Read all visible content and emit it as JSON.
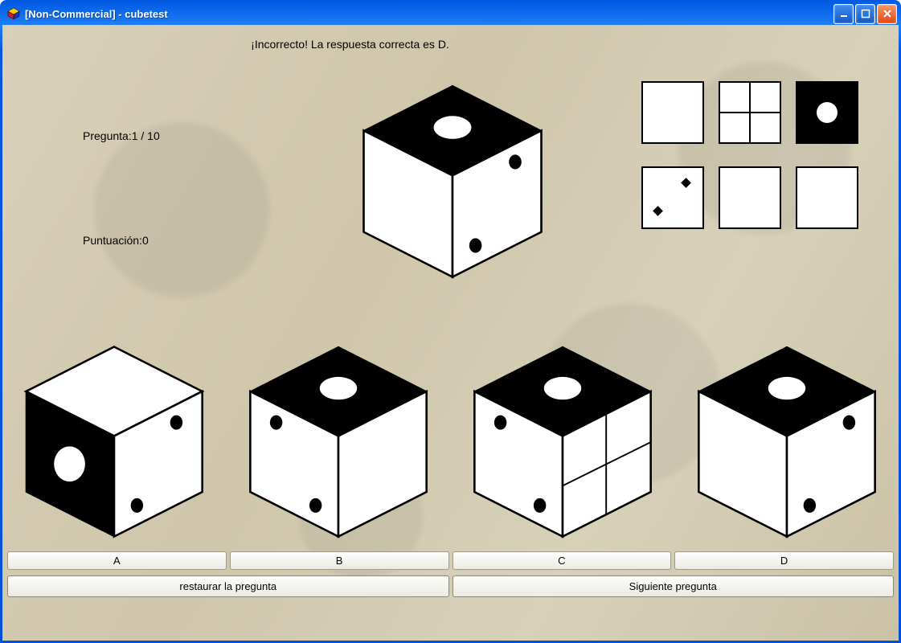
{
  "window": {
    "title": "[Non-Commercial] - cubetest"
  },
  "feedback": "¡Incorrecto! La respuesta correcta es D.",
  "question_label": "Pregunta:1 / 10",
  "score_label": "Puntuación:0",
  "option_labels": [
    "A",
    "B",
    "C",
    "D"
  ],
  "buttons": {
    "restore": "restaurar la pregunta",
    "next": "Siguiente pregunta"
  },
  "legend_faces": [
    {
      "type": "blank"
    },
    {
      "type": "quad"
    },
    {
      "type": "black-circle"
    },
    {
      "type": "two-diamonds"
    },
    {
      "type": "blank"
    },
    {
      "type": "blank"
    }
  ],
  "cubes": {
    "main": {
      "top": "black-circle",
      "left": "blank",
      "right": "two-dots"
    },
    "A": {
      "top": "blank",
      "left": "black-circle",
      "right": "two-dots"
    },
    "B": {
      "top": "black-circle",
      "left": "two-dots",
      "right": "blank"
    },
    "C": {
      "top": "black-circle",
      "left": "two-dots",
      "right": "quad"
    },
    "D": {
      "top": "black-circle",
      "left": "blank",
      "right": "two-dots"
    }
  }
}
